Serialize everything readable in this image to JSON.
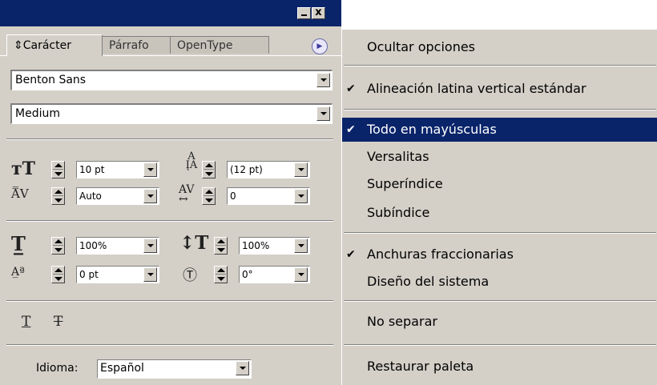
{
  "window": {
    "minimize_label": "",
    "close_label": "x"
  },
  "tabs": [
    {
      "label": "⇕Carácter",
      "active": true
    },
    {
      "label": "Párrafo"
    },
    {
      "label": "OpenType"
    }
  ],
  "character": {
    "font_family": "Benton Sans",
    "font_style": "Medium",
    "size": "10 pt",
    "leading": "(12 pt)",
    "kerning": "Auto",
    "tracking": "0",
    "vertical_scale": "100%",
    "horizontal_scale": "100%",
    "baseline_shift": "0 pt",
    "skew": "0°",
    "language_label": "Idioma:",
    "language": "Español"
  },
  "menu": {
    "items": [
      {
        "label": "Ocultar opciones",
        "checked": false
      },
      {
        "label": "Alineación latina vertical estándar",
        "checked": true
      },
      {
        "label": "Todo en mayúsculas",
        "checked": true,
        "highlighted": true
      },
      {
        "label": "Versalitas",
        "checked": false
      },
      {
        "label": "Superíndice",
        "checked": false
      },
      {
        "label": "Subíndice",
        "checked": false
      },
      {
        "label": "Anchuras fraccionarias",
        "checked": true
      },
      {
        "label": "Diseño del sistema",
        "checked": false
      },
      {
        "label": "No separar",
        "checked": false
      },
      {
        "label": "Restaurar paleta",
        "checked": false
      }
    ],
    "check_glyph": "✔"
  },
  "colors": {
    "titlebar": "#0a246a",
    "face": "#d4d0c8",
    "highlight": "#0a246a"
  }
}
